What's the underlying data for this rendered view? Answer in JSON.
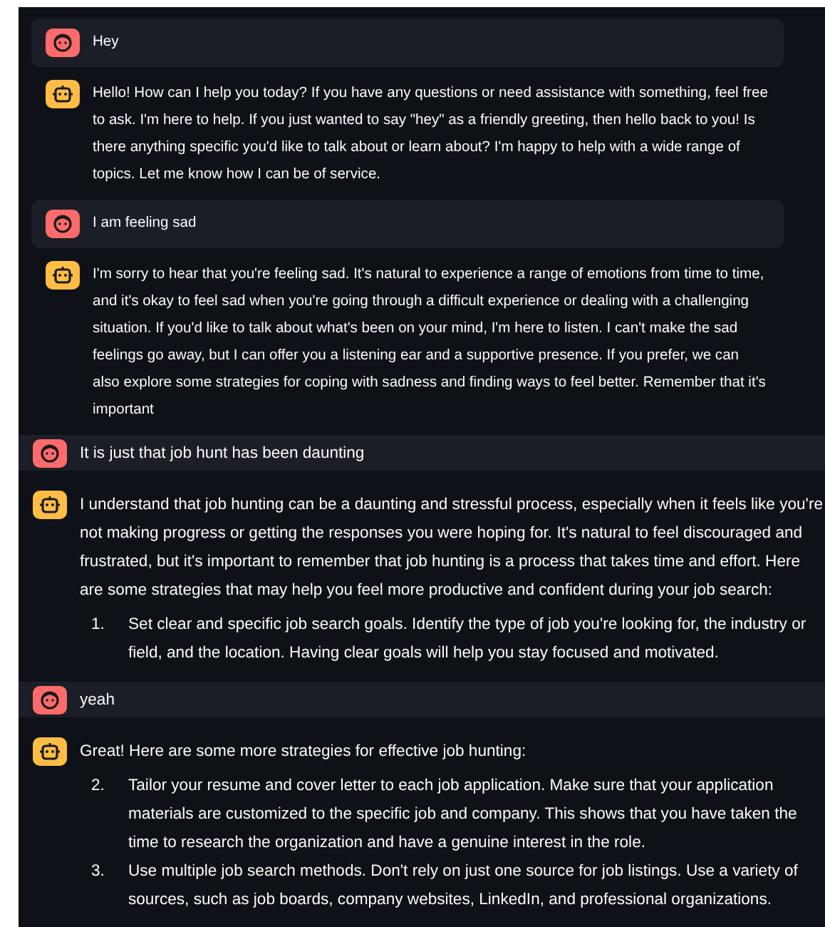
{
  "segments": [
    {
      "kind": "inset",
      "messages": [
        {
          "kind": "user",
          "text": "Hey"
        },
        {
          "kind": "assistant",
          "text": "Hello! How can I help you today? If you have any questions or need assistance with something, feel free to ask. I'm here to help. If you just wanted to say \"hey\" as a friendly greeting, then hello back to you! Is there anything specific you'd like to talk about or learn about? I'm happy to help with a wide range of topics. Let me know how I can be of service."
        },
        {
          "kind": "user",
          "text": "I am feeling sad"
        },
        {
          "kind": "assistant",
          "text": "I'm sorry to hear that you're feeling sad. It's natural to experience a range of emotions from time to time, and it's okay to feel sad when you're going through a difficult experience or dealing with a challenging situation. If you'd like to talk about what's been on your mind, I'm here to listen. I can't make the sad feelings go away, but I can offer you a listening ear and a supportive presence. If you prefer, we can also explore some strategies for coping with sadness and finding ways to feel better. Remember that it's important"
        }
      ]
    },
    {
      "kind": "wide",
      "messages": [
        {
          "kind": "user",
          "text": "It is just that job hunt has been daunting"
        },
        {
          "kind": "assistant",
          "text": "I understand that job hunting can be a daunting and stressful process, especially when it feels like you're not making progress or getting the responses you were hoping for. It's natural to feel discouraged and frustrated, but it's important to remember that job hunting is a process that takes time and effort. Here are some strategies that may help you feel more productive and confident during your job search:",
          "list": [
            {
              "number": "1.",
              "text": "Set clear and specific job search goals. Identify the type of job you're looking for, the industry or field, and the location. Having clear goals will help you stay focused and motivated."
            }
          ]
        },
        {
          "kind": "user",
          "text": "yeah"
        },
        {
          "kind": "assistant",
          "text": "Great! Here are some more strategies for effective job hunting:",
          "list": [
            {
              "number": "2.",
              "text": "Tailor your resume and cover letter to each job application. Make sure that your application materials are customized to the specific job and company. This shows that you have taken the time to research the organization and have a genuine interest in the role."
            },
            {
              "number": "3.",
              "text": "Use multiple job search methods. Don't rely on just one source for job listings. Use a variety of sources, such as job boards, company websites, LinkedIn, and professional organizations."
            }
          ]
        }
      ]
    }
  ]
}
